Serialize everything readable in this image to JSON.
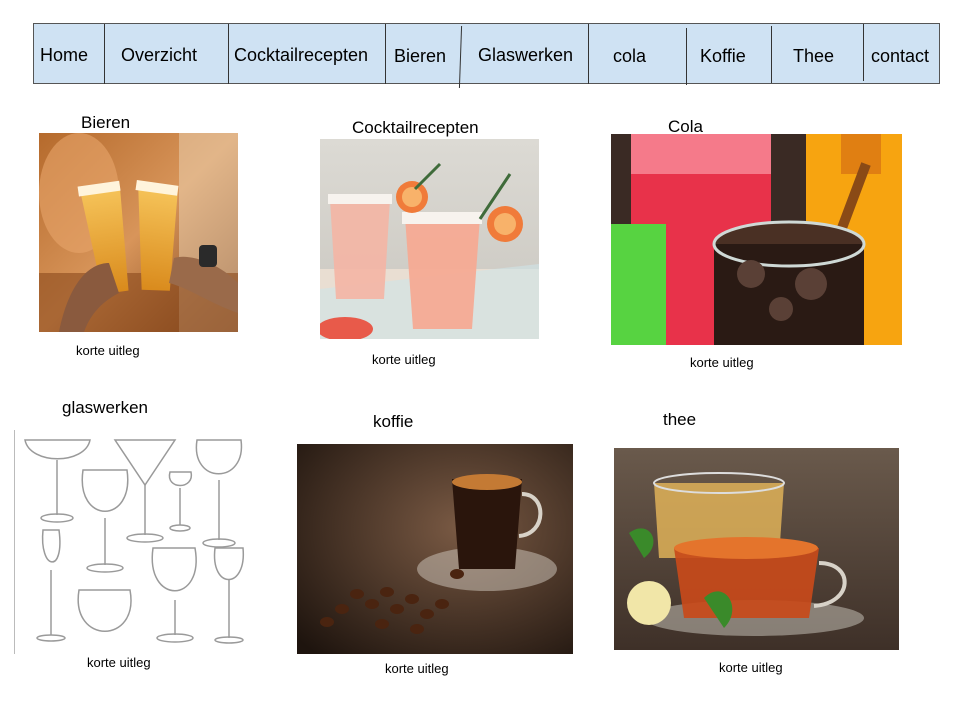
{
  "nav": {
    "items": [
      {
        "id": "home",
        "label": "Home"
      },
      {
        "id": "overzicht",
        "label": "Overzicht"
      },
      {
        "id": "cocktailrecepten",
        "label": "Cocktailrecepten"
      },
      {
        "id": "bieren",
        "label": "Bieren"
      },
      {
        "id": "glaswerken",
        "label": "Glaswerken"
      },
      {
        "id": "cola",
        "label": "cola"
      },
      {
        "id": "koffie",
        "label": "Koffie"
      },
      {
        "id": "thee",
        "label": "Thee"
      },
      {
        "id": "contact",
        "label": "contact"
      }
    ]
  },
  "cards": [
    {
      "title": "Bieren",
      "desc": "korte uitleg"
    },
    {
      "title": "Cocktailrecepten",
      "desc": "korte uitleg"
    },
    {
      "title": "Cola",
      "desc": "korte uitleg"
    },
    {
      "title": "glaswerken",
      "desc": "korte uitleg"
    },
    {
      "title": "koffie",
      "desc": "korte uitleg"
    },
    {
      "title": "thee",
      "desc": "korte uitleg"
    }
  ],
  "colors": {
    "nav_bg": "#cfe2f3",
    "nav_border": "#555555"
  }
}
